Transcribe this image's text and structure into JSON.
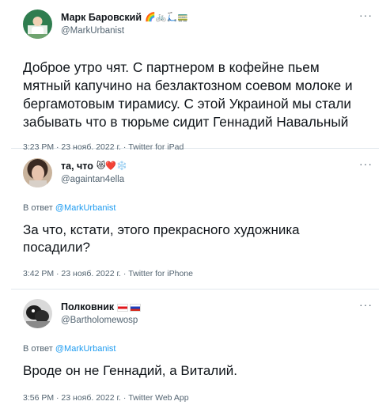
{
  "tweets": [
    {
      "display_name": "Марк Баровский",
      "name_emojis": "🌈🚲🛴🚃",
      "handle": "@MarkUrbanist",
      "reply_prefix": "",
      "reply_handle": "",
      "text": "Доброе утро чят. С партнером в кофейне пьем\nмятный капучино на безлактозном соевом молоке и\nбергамотовым тирамису. С этой Украиной мы стали\nзабывать что в тюрьме сидит Геннадий Навальный",
      "timestamp": "3:23 PM · 23 нояб. 2022 г. · Twitter for iPad",
      "more_icon": "more-horizontal-icon"
    },
    {
      "display_name": "та, что",
      "name_emojis": "😻❤️❄️",
      "handle": "@againtan4ella",
      "reply_prefix": "В ответ ",
      "reply_handle": "@MarkUrbanist",
      "text": "За что, кстати, этого прекрасного художника\nпосадили?",
      "timestamp": "3:42 PM · 23 нояб. 2022 г. · Twitter for iPhone",
      "more_icon": "more-horizontal-icon"
    },
    {
      "display_name": "Полковник",
      "name_emojis": "",
      "handle": "@Bartholomewosp",
      "reply_prefix": "В ответ ",
      "reply_handle": "@MarkUrbanist",
      "text": "Вроде он не Геннадий, а Виталий.",
      "timestamp": "3:56 PM · 23 нояб. 2022 г. · Twitter Web App",
      "more_icon": "more-horizontal-icon"
    }
  ],
  "colors": {
    "text": "#0f1419",
    "secondary": "#536471",
    "link": "#1d9bf0",
    "divider": "#e1e8ed"
  }
}
